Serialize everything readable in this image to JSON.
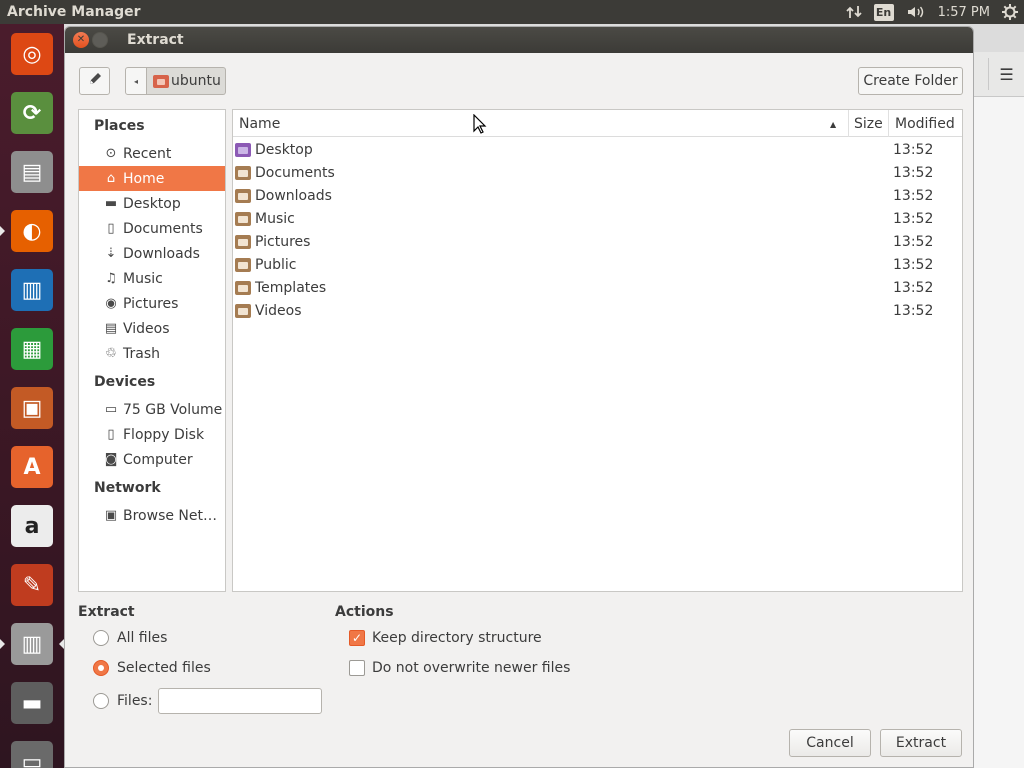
{
  "top_panel": {
    "app_title": "Archive Manager",
    "network_icon": "network-transfer-icon",
    "language": "En",
    "volume_icon": "volume-icon",
    "clock": "1:57 PM",
    "settings_icon": "gear-icon"
  },
  "launcher": {
    "items": [
      {
        "name": "ubuntu-dash-icon",
        "color": "#dd4814"
      },
      {
        "name": "software-updater-icon",
        "color": "#5a8f3e"
      },
      {
        "name": "files-icon",
        "color": "#8e8e8e"
      },
      {
        "name": "firefox-icon",
        "color": "#e66000"
      },
      {
        "name": "libreoffice-writer-icon",
        "color": "#1e6fb5"
      },
      {
        "name": "libreoffice-calc-icon",
        "color": "#2c9b3b"
      },
      {
        "name": "libreoffice-impress-icon",
        "color": "#c35a25"
      },
      {
        "name": "ubuntu-software-icon",
        "color": "#e6632c"
      },
      {
        "name": "amazon-icon",
        "color": "#ececec"
      },
      {
        "name": "system-settings-icon",
        "color": "#bf3c1f"
      },
      {
        "name": "archive-manager-icon",
        "color": "#9a9a9a"
      },
      {
        "name": "save-disk-icon",
        "color": "#5e5e5e"
      },
      {
        "name": "trash-icon",
        "color": "#6a6a6a"
      }
    ]
  },
  "dialog": {
    "title": "Extract",
    "close_icon": "close-icon",
    "maximize_icon": "maximize-icon",
    "edit_icon": "pencil-icon",
    "path_back_icon": "chevron-left-icon",
    "path_current": "ubuntu",
    "create_folder": "Create Folder"
  },
  "sidebar": {
    "places_heading": "Places",
    "places": [
      {
        "label": "Recent",
        "icon": "⊙"
      },
      {
        "label": "Home",
        "icon": "⌂",
        "selected": true
      },
      {
        "label": "Desktop",
        "icon": "▬"
      },
      {
        "label": "Documents",
        "icon": "▯"
      },
      {
        "label": "Downloads",
        "icon": "⇣"
      },
      {
        "label": "Music",
        "icon": "♫"
      },
      {
        "label": "Pictures",
        "icon": "◉"
      },
      {
        "label": "Videos",
        "icon": "▤"
      },
      {
        "label": "Trash",
        "icon": "♲"
      }
    ],
    "devices_heading": "Devices",
    "devices": [
      {
        "label": "75 GB Volume",
        "icon": "▭"
      },
      {
        "label": "Floppy Disk",
        "icon": "▯"
      },
      {
        "label": "Computer",
        "icon": "◙"
      }
    ],
    "network_heading": "Network",
    "network": [
      {
        "label": "Browse Net…",
        "icon": "▣"
      }
    ]
  },
  "file_list": {
    "columns": {
      "name": "Name",
      "size": "Size",
      "modified": "Modified"
    },
    "rows": [
      {
        "name": "Desktop",
        "size": "",
        "modified": "13:52"
      },
      {
        "name": "Documents",
        "size": "",
        "modified": "13:52"
      },
      {
        "name": "Downloads",
        "size": "",
        "modified": "13:52"
      },
      {
        "name": "Music",
        "size": "",
        "modified": "13:52"
      },
      {
        "name": "Pictures",
        "size": "",
        "modified": "13:52"
      },
      {
        "name": "Public",
        "size": "",
        "modified": "13:52"
      },
      {
        "name": "Templates",
        "size": "",
        "modified": "13:52"
      },
      {
        "name": "Videos",
        "size": "",
        "modified": "13:52"
      }
    ]
  },
  "extract_options": {
    "heading": "Extract",
    "all_files": "All files",
    "selected_files": "Selected files",
    "files": "Files:",
    "files_value": "",
    "selected": "selected_files"
  },
  "actions": {
    "heading": "Actions",
    "keep_structure": "Keep directory structure",
    "keep_structure_checked": true,
    "no_overwrite": "Do not overwrite newer files",
    "no_overwrite_checked": false
  },
  "buttons": {
    "cancel": "Cancel",
    "extract": "Extract"
  },
  "colors": {
    "accent": "#f07746",
    "titlebar": "#3c3b37",
    "launcher": "#3a1724"
  }
}
